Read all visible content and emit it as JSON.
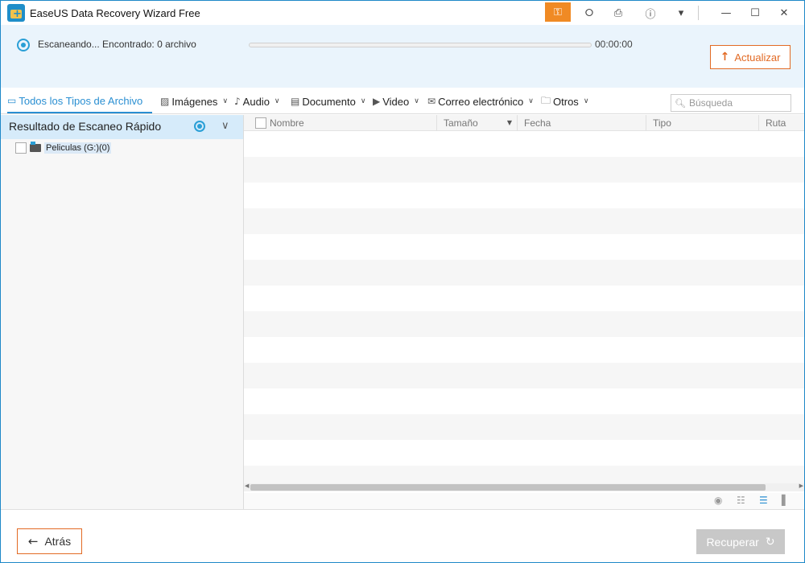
{
  "window": {
    "title": "EaseUS Data Recovery Wizard Free",
    "controls": {
      "key": "key-icon",
      "share": "share-icon",
      "login": "sign-in-icon",
      "help": "?",
      "menu": "dropdown-icon"
    }
  },
  "scan": {
    "status": "Escaneando... Encontrado: 0 archivo",
    "time": "00:00:00",
    "progress_fraction": 0,
    "update_label": "Actualizar"
  },
  "filters": {
    "all": "Todos los Tipos de Archivo",
    "images": "Imágenes",
    "audio": "Audio",
    "document": "Documento",
    "video": "Video",
    "email": "Correo electrónico",
    "others": "Otros"
  },
  "search": {
    "placeholder": "Búsqueda"
  },
  "tree": {
    "title": "Resultado de Escaneo Rápido",
    "items": [
      {
        "label": "Peliculas (G:)(0)"
      }
    ]
  },
  "table": {
    "columns": {
      "name": "Nombre",
      "size": "Tamaño",
      "date": "Fecha",
      "type": "Tipo",
      "path": "Ruta"
    }
  },
  "footer": {
    "back_label": "Atrás",
    "recover_label": "Recuperar"
  },
  "colors": {
    "accent": "#2a8fd2",
    "orange": "#e26a24",
    "header_bg": "#eaf4fc"
  }
}
